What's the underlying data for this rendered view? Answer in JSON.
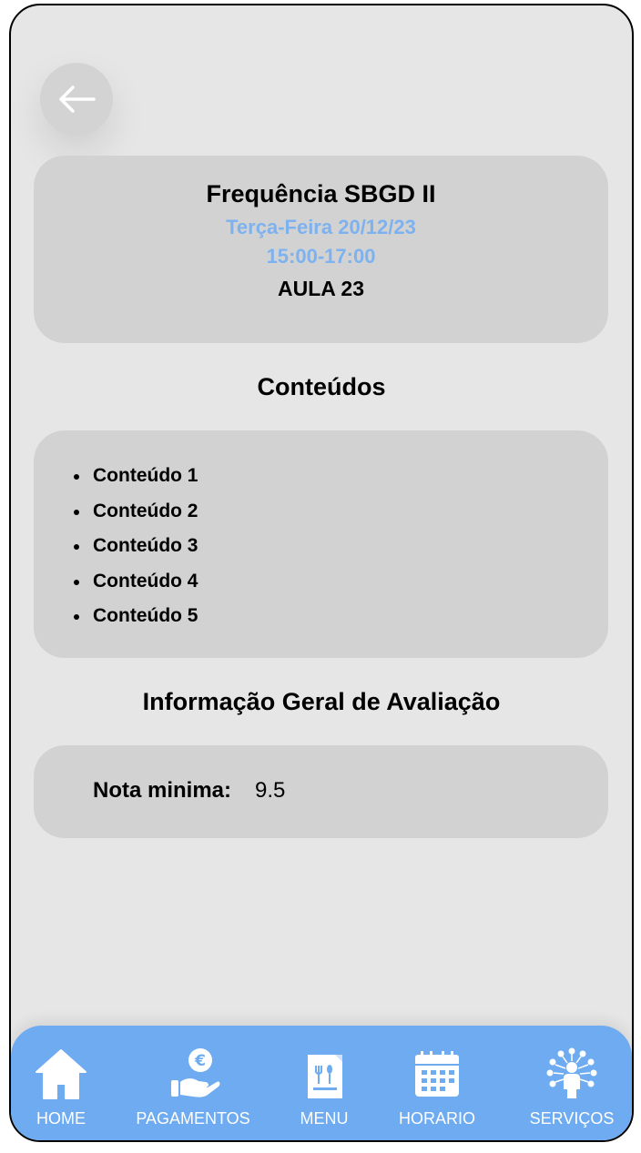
{
  "header": {
    "back_icon": "arrow-left-icon"
  },
  "class_info": {
    "title": "Frequência SBGD II",
    "date": "Terça-Feira 20/12/23",
    "time": "15:00-17:00",
    "lesson": "AULA 23"
  },
  "contents": {
    "title": "Conteúdos",
    "items": [
      "Conteúdo 1",
      "Conteúdo 2",
      "Conteúdo 3",
      "Conteúdo 4",
      "Conteúdo 5"
    ]
  },
  "evaluation": {
    "title": "Informação Geral de Avaliação",
    "min_grade_label": "Nota minima:",
    "min_grade_value": "9.5"
  },
  "nav": {
    "items": [
      {
        "label": "HOME",
        "icon": "home-icon"
      },
      {
        "label": "PAGAMENTOS",
        "icon": "payment-icon"
      },
      {
        "label": "MENU",
        "icon": "menu-icon"
      },
      {
        "label": "HORARIO",
        "icon": "calendar-icon"
      },
      {
        "label": "SERVIÇOS",
        "icon": "services-icon"
      }
    ]
  },
  "colors": {
    "accent": "#6eabf0",
    "highlight_text": "#7eb2ef",
    "card": "#d2d2d2",
    "background": "#e6e6e6"
  }
}
